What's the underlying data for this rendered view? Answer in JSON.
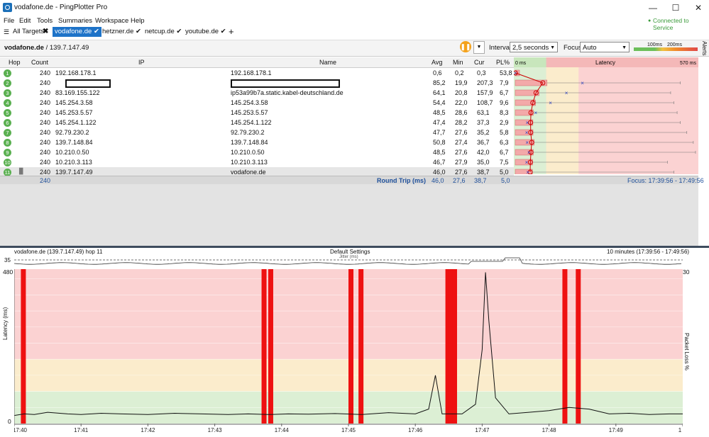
{
  "window": {
    "title": "vodafone.de - PingPlotter Pro"
  },
  "menu": [
    "File",
    "Edit",
    "Tools",
    "Summaries",
    "Workspace",
    "Help"
  ],
  "connection_status": "Connected to Service",
  "tabs": {
    "all_targets": "All Targets",
    "items": [
      "vodafone.de",
      "hetzner.de",
      "netcup.de",
      "youtube.de"
    ]
  },
  "target": {
    "name": "vodafone.de",
    "ip": "/ 139.7.147.49"
  },
  "controls": {
    "interval_label": "Interval",
    "interval_value": "2,5 seconds",
    "focus_label": "Focus",
    "focus_value": "Auto",
    "legend_100": "100ms",
    "legend_200": "200ms",
    "alerts_label": "Alerts"
  },
  "table": {
    "headers": [
      "Hop",
      "Count",
      "IP",
      "Name",
      "Avg",
      "Min",
      "Cur",
      "PL%"
    ],
    "latency_header": "Latency",
    "latency_min": "0 ms",
    "latency_max": "570 ms",
    "rows": [
      {
        "hop": "1",
        "count": "240",
        "ip": "192.168.178.1",
        "name": "192.168.178.1",
        "avg": "0,6",
        "min": "0,2",
        "cur": "0,3",
        "pl": "53,8",
        "avg_ms": 0.6,
        "min_ms": 0.2,
        "cur_ms": 0.3,
        "max_ms": 0.9,
        "pl_pct": 53.8
      },
      {
        "hop": "2",
        "count": "240",
        "ip": "",
        "name": "",
        "avg": "85,2",
        "min": "19,9",
        "cur": "207,3",
        "pl": "7,9",
        "avg_ms": 85.2,
        "min_ms": 19.9,
        "cur_ms": 207.3,
        "max_ms": 510,
        "pl_pct": 7.9
      },
      {
        "hop": "3",
        "count": "240",
        "ip": "83.169.155.122",
        "name": "ip53a99b7a.static.kabel-deutschland.de",
        "avg": "64,1",
        "min": "20,8",
        "cur": "157,9",
        "pl": "6,7",
        "avg_ms": 64.1,
        "min_ms": 20.8,
        "cur_ms": 157.9,
        "max_ms": 480,
        "pl_pct": 6.7
      },
      {
        "hop": "4",
        "count": "240",
        "ip": "145.254.3.58",
        "name": "145.254.3.58",
        "avg": "54,4",
        "min": "22,0",
        "cur": "108,7",
        "pl": "9,6",
        "avg_ms": 54.4,
        "min_ms": 22.0,
        "cur_ms": 108.7,
        "max_ms": 490,
        "pl_pct": 9.6
      },
      {
        "hop": "5",
        "count": "240",
        "ip": "145.253.5.57",
        "name": "145.253.5.57",
        "avg": "48,5",
        "min": "28,6",
        "cur": "63,1",
        "pl": "8,3",
        "avg_ms": 48.5,
        "min_ms": 28.6,
        "cur_ms": 63.1,
        "max_ms": 500,
        "pl_pct": 8.3
      },
      {
        "hop": "6",
        "count": "240",
        "ip": "145.254.1.122",
        "name": "145.254.1.122",
        "avg": "47,4",
        "min": "28,2",
        "cur": "37,3",
        "pl": "2,9",
        "avg_ms": 47.4,
        "min_ms": 28.2,
        "cur_ms": 37.3,
        "max_ms": 510,
        "pl_pct": 2.9
      },
      {
        "hop": "7",
        "count": "240",
        "ip": "92.79.230.2",
        "name": "92.79.230.2",
        "avg": "47,7",
        "min": "27,6",
        "cur": "35,2",
        "pl": "5,8",
        "avg_ms": 47.7,
        "min_ms": 27.6,
        "cur_ms": 35.2,
        "max_ms": 530,
        "pl_pct": 5.8
      },
      {
        "hop": "8",
        "count": "240",
        "ip": "139.7.148.84",
        "name": "139.7.148.84",
        "avg": "50,8",
        "min": "27,4",
        "cur": "36,7",
        "pl": "6,3",
        "avg_ms": 50.8,
        "min_ms": 27.4,
        "cur_ms": 36.7,
        "max_ms": 550,
        "pl_pct": 6.3
      },
      {
        "hop": "9",
        "count": "240",
        "ip": "10.210.0.50",
        "name": "10.210.0.50",
        "avg": "48,5",
        "min": "27,6",
        "cur": "42,0",
        "pl": "6,7",
        "avg_ms": 48.5,
        "min_ms": 27.6,
        "cur_ms": 42.0,
        "max_ms": 560,
        "pl_pct": 6.7
      },
      {
        "hop": "10",
        "count": "240",
        "ip": "10.210.3.113",
        "name": "10.210.3.113",
        "avg": "46,7",
        "min": "27,9",
        "cur": "35,0",
        "pl": "7,5",
        "avg_ms": 46.7,
        "min_ms": 27.9,
        "cur_ms": 35.0,
        "max_ms": 470,
        "pl_pct": 7.5
      },
      {
        "hop": "11",
        "count": "240",
        "ip": "139.7.147.49",
        "name": "vodafone.de",
        "avg": "46,0",
        "min": "27,6",
        "cur": "38,7",
        "pl": "5,0",
        "avg_ms": 46.0,
        "min_ms": 27.6,
        "cur_ms": 38.7,
        "max_ms": 490,
        "pl_pct": 5.0
      }
    ],
    "summary": {
      "count": "240",
      "label": "Round Trip (ms)",
      "avg": "46,0",
      "min": "27,6",
      "cur": "38,7",
      "pl": "5,0",
      "focus": "Focus: 17:39:56 - 17:49:56"
    }
  },
  "graph": {
    "left_title": "vodafone.de (139.7.147.49) hop 11",
    "center_title": "Default Settings",
    "right_title": "10 minutes (17:39:56 - 17:49:56)",
    "jitter_label": "Jitter (ms)",
    "jitter_tick": "35",
    "y_label": "Latency (ms)",
    "y2_label": "Packet Loss %",
    "y_top": "480",
    "y_bottom": "0",
    "y2_top": "30",
    "x_ticks": [
      "17:40",
      "17:41",
      "17:42",
      "17:43",
      "17:44",
      "17:45",
      "17:46",
      "17:47",
      "17:48",
      "17:49",
      "1"
    ]
  },
  "chart_data": {
    "type": "line",
    "title": "Default Settings",
    "ylabel": "Latency (ms)",
    "y2label": "Packet Loss %",
    "ylim": [
      0,
      480
    ],
    "y2lim": [
      0,
      30
    ],
    "x_range_minutes": [
      0,
      10
    ],
    "x_tick_labels": [
      "17:40",
      "17:41",
      "17:42",
      "17:43",
      "17:44",
      "17:45",
      "17:46",
      "17:47",
      "17:48",
      "17:49",
      "1"
    ],
    "series": [
      {
        "values_minute_latency": [
          [
            0.0,
            25
          ],
          [
            0.15,
            30
          ],
          [
            0.3,
            28
          ],
          [
            0.5,
            35
          ],
          [
            0.8,
            30
          ],
          [
            1.0,
            28
          ],
          [
            1.3,
            32
          ],
          [
            1.6,
            30
          ],
          [
            2.0,
            28
          ],
          [
            2.4,
            32
          ],
          [
            2.8,
            30
          ],
          [
            3.2,
            28
          ],
          [
            3.5,
            30
          ],
          [
            3.8,
            28
          ],
          [
            4.1,
            30
          ],
          [
            4.4,
            29
          ],
          [
            4.8,
            31
          ],
          [
            5.2,
            28
          ],
          [
            5.6,
            34
          ],
          [
            6.0,
            30
          ],
          [
            6.2,
            45
          ],
          [
            6.3,
            150
          ],
          [
            6.4,
            30
          ],
          [
            6.7,
            30
          ],
          [
            6.9,
            60
          ],
          [
            7.0,
            230
          ],
          [
            7.05,
            470
          ],
          [
            7.1,
            320
          ],
          [
            7.15,
            200
          ],
          [
            7.2,
            80
          ],
          [
            7.4,
            30
          ],
          [
            7.7,
            35
          ],
          [
            8.0,
            40
          ],
          [
            8.3,
            50
          ],
          [
            8.6,
            45
          ],
          [
            8.9,
            30
          ],
          [
            9.2,
            32
          ],
          [
            9.5,
            28
          ],
          [
            9.8,
            30
          ],
          [
            10.0,
            30
          ]
        ]
      },
      {
        "loss_minutes": [
          0.1,
          3.7,
          3.8,
          5.0,
          5.15,
          6.45,
          6.5,
          6.55,
          8.2,
          8.4
        ]
      }
    ],
    "zones": {
      "green_to": 100,
      "yellow_to": 200,
      "red_to": 480
    }
  },
  "colors": {
    "accent": "#1e73c8",
    "loss_red": "#ee1111",
    "zone_green": "#dcefd4",
    "zone_yellow": "#fbeccc",
    "zone_red": "#fbd2d2",
    "hop_green": "#5ab050",
    "pause_orange": "#f4a21b"
  }
}
